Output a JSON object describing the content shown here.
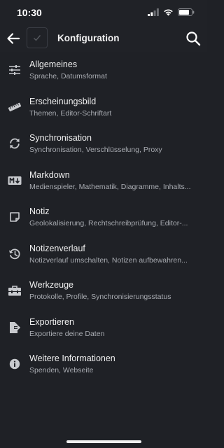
{
  "status": {
    "time": "10:30"
  },
  "appbar": {
    "title": "Konfiguration"
  },
  "items": [
    {
      "label": "Allgemeines",
      "sub": "Sprache, Datumsformat",
      "icon": "sliders-icon"
    },
    {
      "label": "Erscheinungsbild",
      "sub": "Themen, Editor-Schriftart",
      "icon": "ruler-icon"
    },
    {
      "label": "Synchronisation",
      "sub": "Synchronisation, Verschlüsselung, Proxy",
      "icon": "sync-icon"
    },
    {
      "label": "Markdown",
      "sub": "Medienspieler, Mathematik, Diagramme, Inhalts...",
      "icon": "markdown-icon"
    },
    {
      "label": "Notiz",
      "sub": "Geolokalisierung, Rechtschreibprüfung, Editor-...",
      "icon": "sticky-note-icon"
    },
    {
      "label": "Notizenverlauf",
      "sub": "Notizverlauf umschalten, Notizen aufbewahren...",
      "icon": "history-icon"
    },
    {
      "label": "Werkzeuge",
      "sub": "Protokolle, Profile, Synchronisierungsstatus",
      "icon": "toolbox-icon"
    },
    {
      "label": "Exportieren",
      "sub": "Exportiere deine Daten",
      "icon": "file-export-icon"
    },
    {
      "label": "Weitere Informationen",
      "sub": "Spenden, Webseite",
      "icon": "info-icon"
    }
  ]
}
